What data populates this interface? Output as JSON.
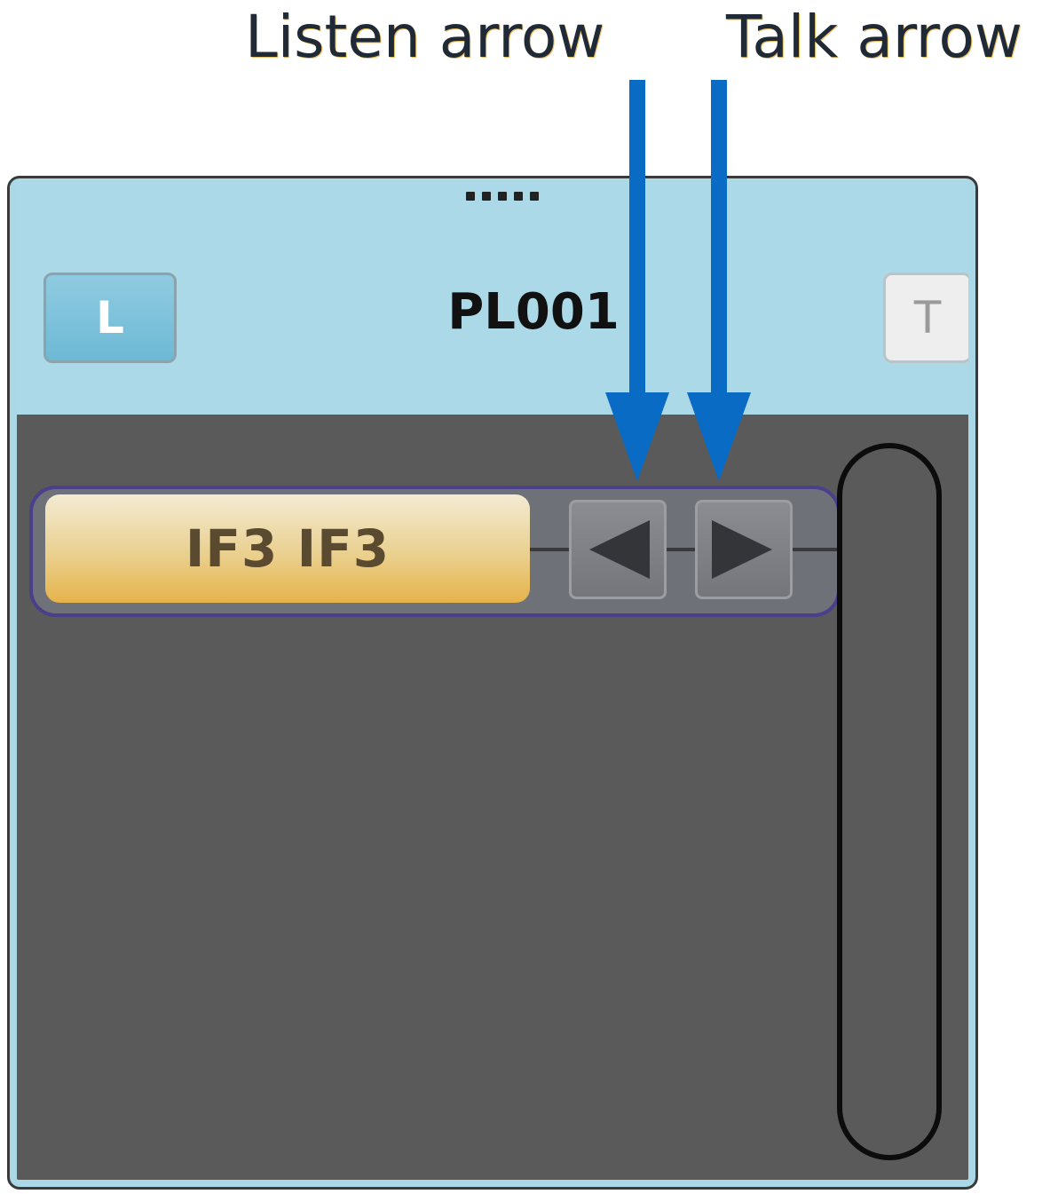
{
  "callouts": {
    "listen": "Listen arrow",
    "talk": "Talk arrow",
    "color": "#0a6bc4"
  },
  "panel": {
    "header": {
      "grip_icon": "drag-handle-dots",
      "listen_button_label": "L",
      "title": "PL001",
      "talk_button_label": "T"
    },
    "channel": {
      "label": "IF3  IF3",
      "listen_arrow_icon": "arrow-left",
      "talk_arrow_icon": "arrow-right"
    }
  },
  "colors": {
    "header_bg": "#acd9e7",
    "body_bg": "#5a5a5a",
    "channel_label_gold": "#e5b34a",
    "row_border": "#4a3f8a"
  }
}
